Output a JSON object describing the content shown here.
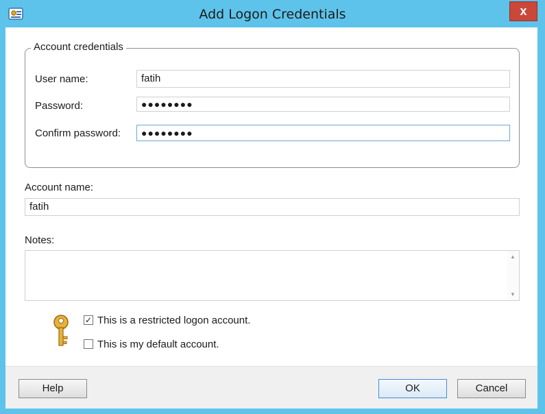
{
  "window": {
    "title": "Add Logon Credentials",
    "close_label": "x"
  },
  "credentials_group": {
    "legend": "Account credentials",
    "user_name_label": "User name:",
    "user_name_value": "fatih",
    "password_label": "Password:",
    "password_value": "●●●●●●●●",
    "confirm_password_label": "Confirm password:",
    "confirm_password_value": "●●●●●●●●"
  },
  "account_name": {
    "label": "Account name:",
    "value": "fatih"
  },
  "notes": {
    "label": "Notes:",
    "value": ""
  },
  "options": {
    "restricted_label": "This is a restricted logon account.",
    "restricted_checked": true,
    "default_label": "This is my default account.",
    "default_checked": false,
    "check_glyph": "✓"
  },
  "buttons": {
    "help": "Help",
    "ok": "OK",
    "cancel": "Cancel"
  },
  "icons": {
    "app": "credentials-icon",
    "key": "key-icon",
    "close": "close-icon"
  },
  "colors": {
    "titlebar": "#5ec3ea",
    "close": "#c9483a",
    "focus_border": "#6aa9d6",
    "default_button_border": "#3d8ee0"
  }
}
